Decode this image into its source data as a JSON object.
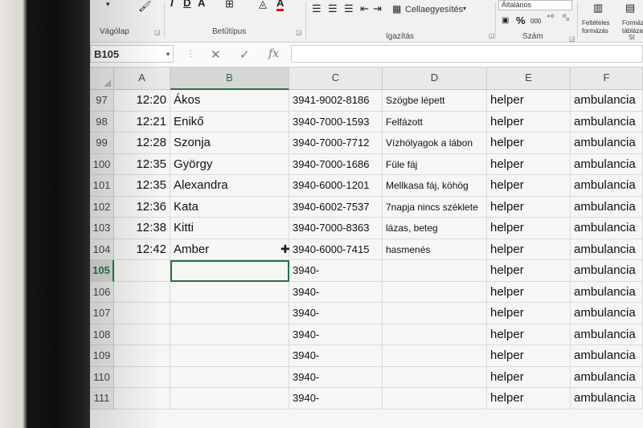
{
  "ribbon": {
    "clipboard_label": "Vágólap",
    "font_label": "Betűtípus",
    "font_buttons": [
      "I",
      "D",
      "A"
    ],
    "align_label": "Igazítás",
    "merge_label": "Cellaegyesítés",
    "number_label": "Szám",
    "number_format": "Általános",
    "percent_symbol": "%",
    "thousands_symbol": "000",
    "conditional_label": "Feltételes formázás",
    "format_table_label": "Formázás táblázat",
    "styles_label": "St"
  },
  "formula_bar": {
    "name_box": "B105",
    "cancel_icon": "✕",
    "enter_icon": "✓",
    "fx_label": "fx",
    "content": ""
  },
  "columns": [
    "A",
    "B",
    "C",
    "D",
    "E",
    "F"
  ],
  "rows": [
    {
      "num": "97",
      "a": "12:20",
      "b": "Ákos",
      "c": "3941-9002-8186",
      "d": "Szögbe lépett",
      "e": "helper",
      "f": "ambulancia"
    },
    {
      "num": "98",
      "a": "12:21",
      "b": "Enikő",
      "c": "3940-7000-1593",
      "d": "Felfázott",
      "e": "helper",
      "f": "ambulancia"
    },
    {
      "num": "99",
      "a": "12:28",
      "b": "Szonja",
      "c": "3940-7000-7712",
      "d": "Vízhólyagok a lábon",
      "e": "helper",
      "f": "ambulancia"
    },
    {
      "num": "100",
      "a": "12:35",
      "b": "György",
      "c": "3940-7000-1686",
      "d": "Füle fáj",
      "e": "helper",
      "f": "ambulancia"
    },
    {
      "num": "101",
      "a": "12:35",
      "b": "Alexandra",
      "c": "3940-6000-1201",
      "d": "Mellkasa fáj, köhög",
      "e": "helper",
      "f": "ambulancia"
    },
    {
      "num": "102",
      "a": "12:36",
      "b": "Kata",
      "c": "3940-6002-7537",
      "d": "7napja nincs széklete",
      "e": "helper",
      "f": "ambulancia"
    },
    {
      "num": "103",
      "a": "12:38",
      "b": "Kitti",
      "c": "3940-7000-8363",
      "d": "lázas, beteg",
      "e": "helper",
      "f": "ambulancia"
    },
    {
      "num": "104",
      "a": "12:42",
      "b": "Amber",
      "c": "3940-6000-7415",
      "d": "hasmenés",
      "e": "helper",
      "f": "ambulancia"
    },
    {
      "num": "105",
      "a": "",
      "b": "",
      "c": "3940-",
      "d": "",
      "e": "helper",
      "f": "ambulancia"
    },
    {
      "num": "106",
      "a": "",
      "b": "",
      "c": "3940-",
      "d": "",
      "e": "helper",
      "f": "ambulancia"
    },
    {
      "num": "107",
      "a": "",
      "b": "",
      "c": "3940-",
      "d": "",
      "e": "helper",
      "f": "ambulancia"
    },
    {
      "num": "108",
      "a": "",
      "b": "",
      "c": "3940-",
      "d": "",
      "e": "helper",
      "f": "ambulancia"
    },
    {
      "num": "109",
      "a": "",
      "b": "",
      "c": "3940-",
      "d": "",
      "e": "helper",
      "f": "ambulancia"
    },
    {
      "num": "110",
      "a": "",
      "b": "",
      "c": "3940-",
      "d": "",
      "e": "helper",
      "f": "ambulancia"
    },
    {
      "num": "111",
      "a": "",
      "b": "",
      "c": "3940-",
      "d": "",
      "e": "helper",
      "f": "ambulancia"
    }
  ],
  "active_cell": "B105",
  "colors": {
    "accent": "#217346",
    "header_bg": "#e9e9e7",
    "grid": "#dadada"
  }
}
